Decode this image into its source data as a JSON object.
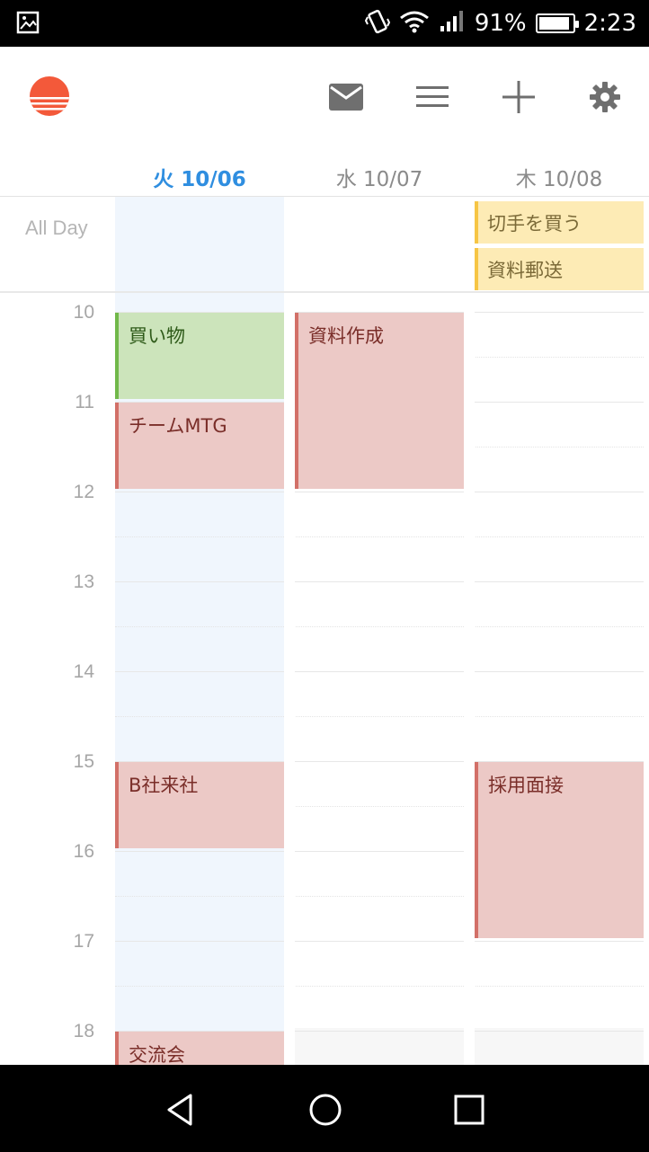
{
  "status_bar": {
    "battery_text": "91%",
    "battery_level": 0.91,
    "time": "2:23",
    "icons": [
      "screenshot-icon",
      "vibrate-icon",
      "wifi-icon",
      "signal-icon",
      "battery-icon"
    ]
  },
  "toolbar": {
    "logo": "sunrise-logo",
    "icons": [
      "mail-icon",
      "menu-icon",
      "add-icon",
      "settings-icon"
    ],
    "accent_color": "#f25a3c"
  },
  "days": [
    {
      "label": "火 10/06",
      "today": true
    },
    {
      "label": "水 10/07",
      "today": false
    },
    {
      "label": "木 10/08",
      "today": false
    }
  ],
  "all_day": {
    "label": "All Day",
    "events": [
      {
        "title": "切手を買う",
        "day": 2
      },
      {
        "title": "資料郵送",
        "day": 2
      }
    ]
  },
  "hours": [
    "10",
    "11",
    "12",
    "13",
    "14",
    "15",
    "16",
    "17",
    "18"
  ],
  "events": [
    {
      "title": "買い物",
      "day": 0,
      "start": 10,
      "end": 11,
      "color": "green"
    },
    {
      "title": "チームMTG",
      "day": 0,
      "start": 11,
      "end": 12,
      "color": "red"
    },
    {
      "title": "資料作成",
      "day": 1,
      "start": 10,
      "end": 12,
      "color": "red"
    },
    {
      "title": "B社来社",
      "day": 0,
      "start": 15,
      "end": 16,
      "color": "red"
    },
    {
      "title": "採用面接",
      "day": 2,
      "start": 15,
      "end": 17,
      "color": "red"
    },
    {
      "title": "交流会",
      "day": 0,
      "start": 18,
      "end": 19,
      "color": "red"
    }
  ],
  "colors": {
    "today_header": "#2f8ee0",
    "today_column": "#f0f6fd",
    "event_red_bg": "#ecc9c6",
    "event_red_border": "#d27068",
    "event_green_bg": "#cce4bb",
    "event_green_border": "#71b84a",
    "allday_bg": "#fdebb5",
    "allday_border": "#f6c544"
  },
  "nav_bar": {
    "icons": [
      "back-icon",
      "home-icon",
      "recents-icon"
    ]
  }
}
